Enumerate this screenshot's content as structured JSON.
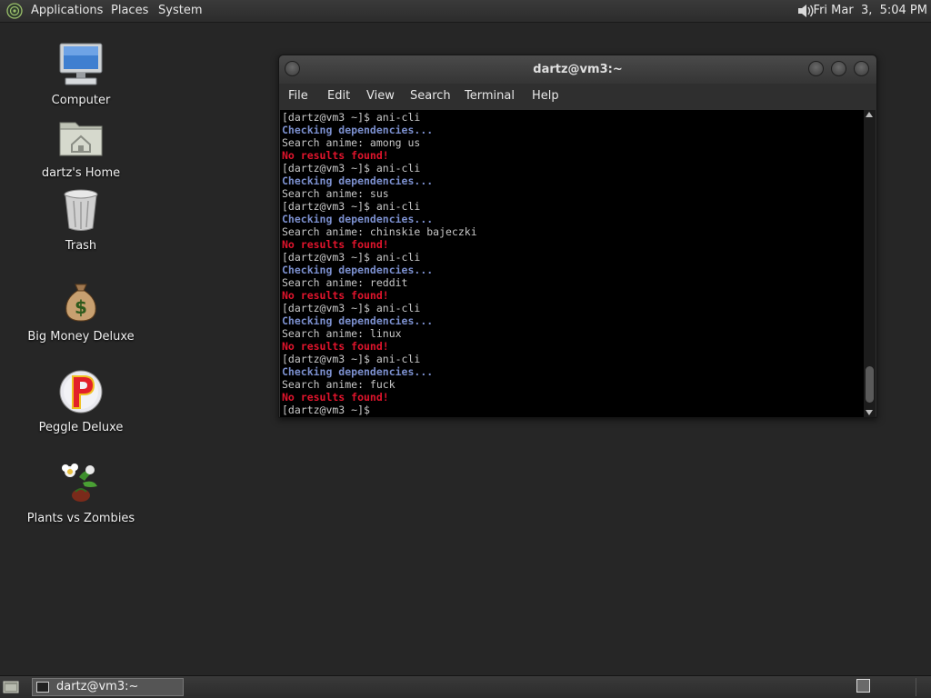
{
  "top_panel": {
    "menus": [
      "Applications",
      "Places",
      "System"
    ],
    "clock": "Fri Mar  3,  5:04 PM",
    "apps_icon": "gnome-foot-icon",
    "volume_icon": "speaker-icon"
  },
  "desktop": {
    "icons": [
      {
        "label": "Computer",
        "icon": "computer-icon"
      },
      {
        "label": "dartz's Home",
        "icon": "home-folder-icon"
      },
      {
        "label": "Trash",
        "icon": "trash-icon"
      },
      {
        "label": "Big Money Deluxe",
        "icon": "money-bag-icon"
      },
      {
        "label": "Peggle Deluxe",
        "icon": "peggle-icon"
      },
      {
        "label": "Plants vs Zombies",
        "icon": "plants-vs-zombies-icon"
      }
    ]
  },
  "terminal": {
    "title": "dartz@vm3:~",
    "menu": [
      "File",
      "Edit",
      "View",
      "Search",
      "Terminal",
      "Help"
    ],
    "lines": [
      {
        "text": "[dartz@vm3 ~]$ ani-cli",
        "kind": "prompt"
      },
      {
        "text": "Checking dependencies...",
        "kind": "check"
      },
      {
        "text": "Search anime: among us",
        "kind": "plain"
      },
      {
        "text": "No results found!",
        "kind": "err"
      },
      {
        "text": "[dartz@vm3 ~]$ ani-cli",
        "kind": "prompt"
      },
      {
        "text": "Checking dependencies...",
        "kind": "check"
      },
      {
        "text": "Search anime: sus",
        "kind": "plain"
      },
      {
        "text": "[dartz@vm3 ~]$ ani-cli",
        "kind": "prompt"
      },
      {
        "text": "Checking dependencies...",
        "kind": "check"
      },
      {
        "text": "Search anime: chinskie bajeczki",
        "kind": "plain"
      },
      {
        "text": "No results found!",
        "kind": "err"
      },
      {
        "text": "[dartz@vm3 ~]$ ani-cli",
        "kind": "prompt"
      },
      {
        "text": "Checking dependencies...",
        "kind": "check"
      },
      {
        "text": "Search anime: reddit",
        "kind": "plain"
      },
      {
        "text": "No results found!",
        "kind": "err"
      },
      {
        "text": "[dartz@vm3 ~]$ ani-cli",
        "kind": "prompt"
      },
      {
        "text": "Checking dependencies...",
        "kind": "check"
      },
      {
        "text": "Search anime: linux",
        "kind": "plain"
      },
      {
        "text": "No results found!",
        "kind": "err"
      },
      {
        "text": "[dartz@vm3 ~]$ ani-cli",
        "kind": "prompt"
      },
      {
        "text": "Checking dependencies...",
        "kind": "check"
      },
      {
        "text": "Search anime: fuck",
        "kind": "plain"
      },
      {
        "text": "No results found!",
        "kind": "err"
      },
      {
        "text": "[dartz@vm3 ~]$",
        "kind": "prompt"
      }
    ]
  },
  "taskbar": {
    "window_button": "dartz@vm3:~",
    "show_desktop_icon": "show-desktop-icon",
    "terminal_icon": "terminal-icon"
  },
  "colors": {
    "desktop_bg": "#262626",
    "check_text": "#7b8fce",
    "error_text": "#e0142c"
  }
}
